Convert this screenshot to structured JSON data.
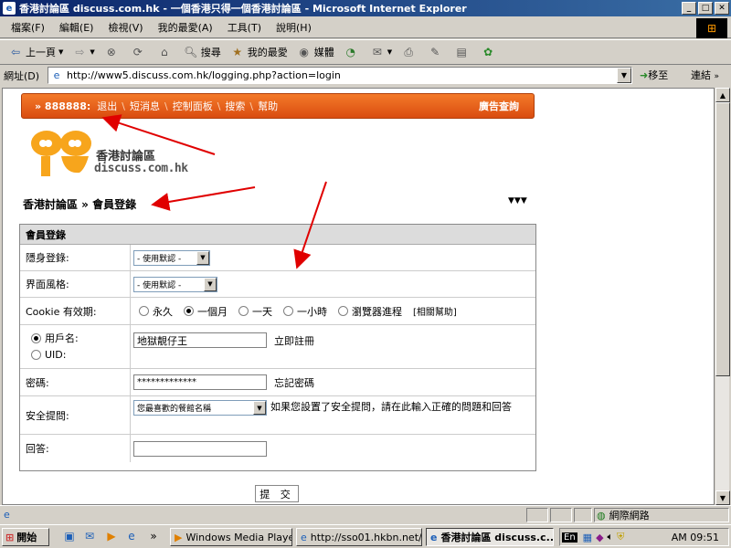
{
  "window": {
    "title": "香港討論區 discuss.com.hk - 一個香港只得一個香港討論區 - Microsoft Internet Explorer"
  },
  "menu": [
    "檔案(F)",
    "編輯(E)",
    "檢視(V)",
    "我的最愛(A)",
    "工具(T)",
    "說明(H)"
  ],
  "toolbar": {
    "back": "上一頁",
    "search": "搜尋",
    "favorites": "我的最愛",
    "media": "媒體"
  },
  "address": {
    "label": "網址(D)",
    "url": "http://www5.discuss.com.hk/logging.php?action=login",
    "go": "移至",
    "links": "連結"
  },
  "nav": {
    "user": "» 888888:",
    "links": [
      "退出",
      "短消息",
      "控制面板",
      "搜索",
      "幫助"
    ],
    "ad": "廣告查詢"
  },
  "logo": {
    "chinese": "香港討論區",
    "english": "discuss.com.hk"
  },
  "breadcrumb": "香港討論區 » 會員登錄",
  "breadcrumb_arrows": "▼▼▼",
  "form": {
    "header": "會員登錄",
    "invisible_label": "隱身登錄:",
    "invisible_value": "- 使用默認 -",
    "style_label": "界面風格:",
    "style_value": "- 使用默認 -",
    "cookie_label": "Cookie 有效期:",
    "cookie_options": [
      "永久",
      "一個月",
      "一天",
      "一小時",
      "瀏覽器進程"
    ],
    "cookie_help": "[相關幫助]",
    "username_label": "用戶名:",
    "uid_label": "UID:",
    "username_value": "地獄靚仔王",
    "register_link": "立即註冊",
    "password_label": "密碼:",
    "password_value": "*************",
    "forgot_link": "忘記密碼",
    "question_label": "安全提問:",
    "question_value": "您最喜歡的餐館名稱",
    "question_hint": "如果您設置了安全提問，請在此輸入正確的問題和回答",
    "answer_label": "回答:",
    "submit": "提 交"
  },
  "status": {
    "zone": "網際網路"
  },
  "taskbar": {
    "start": "開始",
    "tasks": [
      "Windows Media Player",
      "http://sso01.hkbn.net/...",
      "香港討論區 discuss.c..."
    ],
    "lang": "En",
    "clock": "AM 09:51"
  },
  "colors": {
    "nav_bg": "#e85c1a",
    "title_bg": "#0a246a",
    "arrow": "#e00000"
  }
}
